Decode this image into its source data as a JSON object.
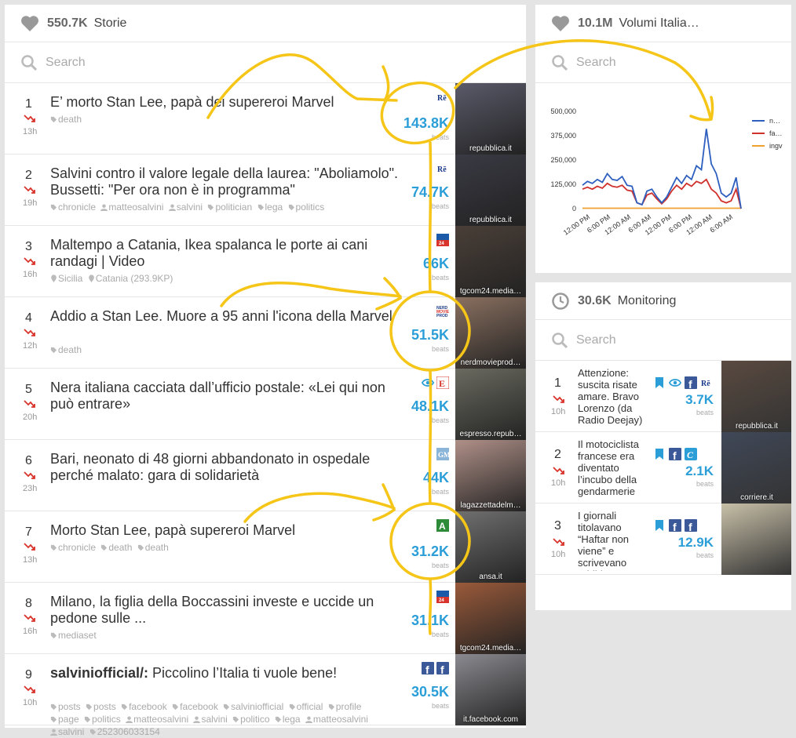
{
  "stories_panel": {
    "count": "550.7K",
    "title": "Storie",
    "search_placeholder": "Search",
    "items": [
      {
        "rank": "1",
        "age": "13h",
        "title_bold": "",
        "title": "E’ morto Stan Lee, papà dei supereroi Marvel",
        "tags": [
          "death"
        ],
        "beats": "143.8K",
        "beats_label": "beats",
        "sources": [
          "repubblica-logo"
        ],
        "thumb_caption": "repubblica.it",
        "thumb_color": "#5a5a6a"
      },
      {
        "rank": "2",
        "age": "19h",
        "title_bold": "",
        "title": "Salvini contro il valore legale della laurea: \"Aboliamolo\". Bussetti: \"Per ora non è in programma\"",
        "tags": [
          "chronicle",
          "matteosalvini",
          "salvini",
          "politician",
          "lega",
          "politics"
        ],
        "beats": "74.7K",
        "beats_label": "beats",
        "sources": [
          "repubblica-logo"
        ],
        "thumb_caption": "repubblica.it",
        "thumb_color": "#3a3a44"
      },
      {
        "rank": "3",
        "age": "16h",
        "title_bold": "",
        "title": "Maltempo a Catania, Ikea spalanca le porte ai cani randagi | Video",
        "tags": [
          "Sicilia",
          "Catania (293.9KP)"
        ],
        "beats": "66K",
        "beats_label": "beats",
        "sources": [
          "tgcom24-logo"
        ],
        "thumb_caption": "tgcom24.media…",
        "thumb_color": "#4a3f38"
      },
      {
        "rank": "4",
        "age": "12h",
        "title_bold": "",
        "title": "Addio a Stan Lee. Muore a 95 anni l'icona della Marvel",
        "tags": [
          "death"
        ],
        "beats": "51.5K",
        "beats_label": "beats",
        "sources": [
          "nerdmovieprod-logo"
        ],
        "thumb_caption": "nerdmovieprod…",
        "thumb_color": "#8a7060"
      },
      {
        "rank": "5",
        "age": "20h",
        "title_bold": "",
        "title": "Nera italiana cacciata dall’ufficio postale: «Lei qui non può entrare»",
        "tags": [],
        "beats": "48.1K",
        "beats_label": "beats",
        "sources": [
          "eye-icon",
          "espresso-logo"
        ],
        "thumb_caption": "espresso.repub…",
        "thumb_color": "#6a6a60"
      },
      {
        "rank": "6",
        "age": "23h",
        "title_bold": "",
        "title": "Bari, neonato di 48 giorni abbandonato in ospedale perché malato: gara di solidarietà",
        "tags": [],
        "beats": "44K",
        "beats_label": "beats",
        "sources": [
          "gazzetta-logo"
        ],
        "thumb_caption": "lagazzettadelm…",
        "thumb_color": "#b09088"
      },
      {
        "rank": "7",
        "age": "13h",
        "title_bold": "",
        "title": "Morto Stan Lee, papà supereroi Marvel",
        "tags": [
          "chronicle",
          "death",
          "death"
        ],
        "beats": "31.2K",
        "beats_label": "beats",
        "sources": [
          "ansa-logo"
        ],
        "thumb_caption": "ansa.it",
        "thumb_color": "#707070"
      },
      {
        "rank": "8",
        "age": "16h",
        "title_bold": "",
        "title": "Milano, la figlia della Boccassini investe e uccide un pedone sulle ...",
        "tags": [
          "mediaset"
        ],
        "beats": "31.1K",
        "beats_label": "beats",
        "sources": [
          "tgcom24-logo"
        ],
        "thumb_caption": "tgcom24.media…",
        "thumb_color": "#9a5a3a"
      },
      {
        "rank": "9",
        "age": "10h",
        "title_bold": "salviniofficial/:",
        "title": " Piccolino l’Italia ti vuole bene!",
        "tags": [
          "posts",
          "posts",
          "facebook",
          "facebook",
          "salviniofficial",
          "official",
          "profile",
          "page",
          "politics",
          "matteosalvini",
          "salvini",
          "politico",
          "lega",
          "matteosalvini",
          "salvini",
          "252306033154"
        ],
        "beats": "30.5K",
        "beats_label": "beats",
        "sources": [
          "facebook-logo",
          "facebook-logo"
        ],
        "thumb_caption": "it.facebook.com",
        "thumb_color": "#8a8a90"
      }
    ]
  },
  "volumes_panel": {
    "count": "10.1M",
    "title": "Volumi Italia…",
    "search_placeholder": "Search"
  },
  "chart_data": {
    "type": "line",
    "x": [
      "12:00 PM",
      "6:00 PM",
      "12:00 AM",
      "6:00 AM",
      "12:00 PM",
      "6:00 PM",
      "12:00 AM",
      "6:00 AM"
    ],
    "y_ticks": [
      "500,000",
      "375,000",
      "250,000",
      "125,000",
      "0"
    ],
    "ylim": [
      0,
      500000
    ],
    "legend_position": "right",
    "series": [
      {
        "name": "n…",
        "color": "#2e5fbf",
        "values": [
          120000,
          140000,
          130000,
          150000,
          135000,
          180000,
          150000,
          145000,
          165000,
          120000,
          115000,
          30000,
          20000,
          90000,
          100000,
          60000,
          30000,
          60000,
          110000,
          160000,
          130000,
          170000,
          150000,
          220000,
          200000,
          410000,
          230000,
          180000,
          80000,
          60000,
          80000,
          160000,
          0
        ]
      },
      {
        "name": "fa…",
        "color": "#d0312d",
        "values": [
          100000,
          110000,
          100000,
          115000,
          105000,
          130000,
          115000,
          110000,
          120000,
          95000,
          90000,
          30000,
          20000,
          70000,
          80000,
          50000,
          25000,
          50000,
          90000,
          120000,
          100000,
          130000,
          115000,
          140000,
          130000,
          150000,
          100000,
          80000,
          40000,
          30000,
          40000,
          100000,
          0
        ]
      },
      {
        "name": "ingv",
        "color": "#f0a030",
        "values": [
          2000,
          2000,
          2000,
          2000,
          2000,
          2000,
          2000,
          2000,
          2000,
          2000,
          2000,
          2000,
          2000,
          2000,
          2000,
          2000,
          2000,
          2000,
          2000,
          2000,
          2000,
          2000,
          2000,
          2000,
          2000,
          2000,
          2000,
          2000,
          2000,
          2000,
          2000,
          2000,
          2000
        ]
      }
    ]
  },
  "monitoring_panel": {
    "count": "30.6K",
    "title": "Monitoring",
    "search_placeholder": "Search",
    "items": [
      {
        "rank": "1",
        "age": "10h",
        "title": "Attenzione: suscita risate amare. Bravo Lorenzo (da Radio Deejay)",
        "beats": "3.7K",
        "beats_label": "beats",
        "icons": [
          "bookmark-icon",
          "eye-icon",
          "facebook-logo",
          "repubblica-logo"
        ],
        "thumb_caption": "repubblica.it",
        "thumb_color": "#5a4a40"
      },
      {
        "rank": "2",
        "age": "10h",
        "title": "Il motociclista francese era diventato l’incubo della gendarmerie",
        "beats": "2.1K",
        "beats_label": "beats",
        "icons": [
          "bookmark-icon",
          "facebook-logo",
          "corriere-logo"
        ],
        "thumb_caption": "corriere.it",
        "thumb_color": "#404858"
      },
      {
        "rank": "3",
        "age": "10h",
        "title": "I giornali titolavano “Haftar non viene” e scrivevano addirittura “Conferenza flop”",
        "beats": "12.9K",
        "beats_label": "beats",
        "icons": [
          "bookmark-icon",
          "facebook-logo",
          "facebook-logo"
        ],
        "thumb_caption": "",
        "thumb_color": "#c8c0a8"
      }
    ]
  },
  "colors": {
    "accent": "#2b9ed8",
    "trend_down": "#d9342b",
    "highlight": "#f5c518"
  }
}
